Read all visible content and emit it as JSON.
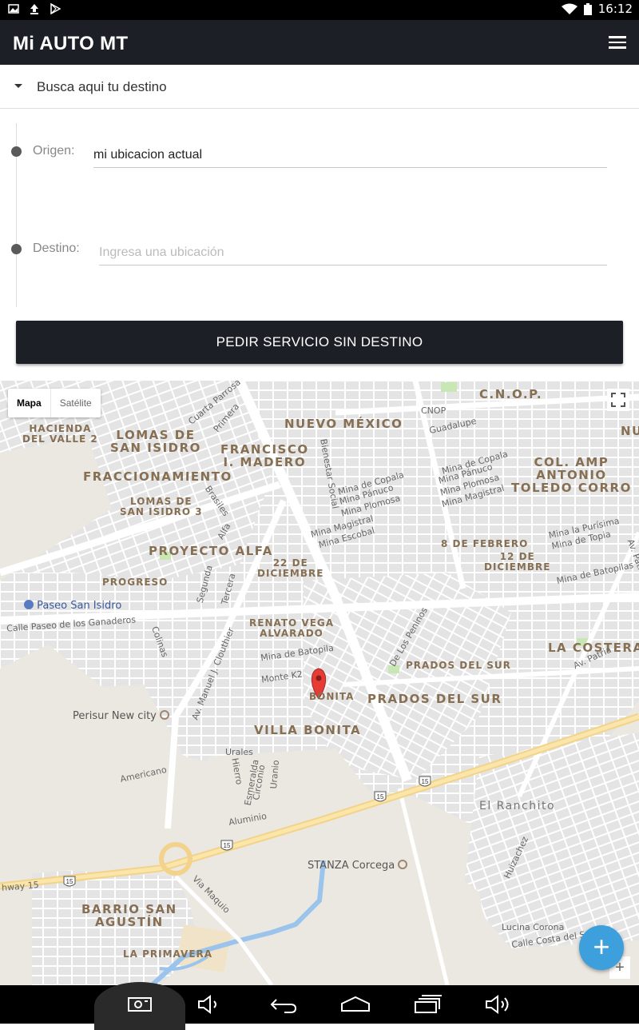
{
  "status_bar": {
    "time": "16:12",
    "icons": [
      "image-icon",
      "upload-icon",
      "play-store-icon",
      "wifi-icon",
      "battery-icon"
    ]
  },
  "app_bar": {
    "title": "Mi AUTO MT",
    "menu_icon": "hamburger-menu-icon"
  },
  "search_toggle": {
    "label": "Busca aqui tu destino",
    "icon": "caret-down-icon"
  },
  "form": {
    "origin_label": "Origen:",
    "origin_value": "mi ubicacion actual",
    "destination_label": "Destino:",
    "destination_placeholder": "Ingresa una ubicación",
    "destination_value": "",
    "request_button": "PEDIR SERVICIO SIN DESTINO"
  },
  "map": {
    "type_controls": {
      "map": "Mapa",
      "satellite": "Satélite",
      "selected": "Mapa"
    },
    "fullscreen_icon": "fullscreen-icon",
    "marker_icon": "red-map-pin-icon",
    "neighborhoods": {
      "cnop": "C.N.O.P.",
      "nuevo_mexico": "NUEVO MÉXICO",
      "nu": "NU",
      "hacienda_del_valle_2": "HACIENDA\nDEL VALLE 2",
      "lomas_de_san_isidro": "LOMAS DE\nSAN ISIDRO",
      "francisco_madero": "FRANCISCO\nI. MADERO",
      "fraccionamiento": "FRACCIONAMIENTO",
      "lomas_de_san_isidro_3": "LOMAS DE\nSAN ISIDRO 3",
      "col_amp_antonio": "COL. AMP\nANTONIO\nTOLEDO CORRO",
      "proyecto_alfa": "PROYECTO ALFA",
      "veintidos_diciembre": "22 DE\nDICIEMBRE",
      "ocho_febrero": "8 DE FEBRERO",
      "doce_diciembre": "12 DE\nDICIEMBRE",
      "progreso": "PROGRESO",
      "renato_vega": "RENATO VEGA\nALVARADO",
      "la_costera": "LA COSTERA",
      "prados_del_sur_small": "PRADOS DEL SUR",
      "prados_del_sur": "PRADOS DEL SUR",
      "bonita": "BONITA",
      "villa_bonita": "VILLA BONITA",
      "barrio_san_agustin": "BARRIO SAN\nAGUSTÍN",
      "la_primavera": "LA PRIMAVERA",
      "el_ranchito": "El Ranchito"
    },
    "streets": {
      "cuarta_parrosa": "Cuarta Parrosa",
      "primera": "Primera",
      "cnop_street": "CNOP",
      "guadalupe": "Guadalupe",
      "bienestar_social": "Bienestar Social",
      "mina_copala_a": "Mina de Copala",
      "mina_panuco_a": "Mina Pánuco",
      "mina_plomosa_a": "Mina Plomosa",
      "mina_magistral_a": "Mina Magistral",
      "mina_escobal": "Mina Escobal",
      "mina_copala_b": "Mina de Copala",
      "mina_panuco_b": "Mina Pánuco",
      "mina_plomosa_b": "Mina Plomosa",
      "mina_magistral_b": "Mina Magistral",
      "mina_purisima": "Mina la Purísima",
      "mina_topia": "Mina de Topia",
      "mina_batopilas_a": "Mina de Batopilas",
      "av_patria_a": "Av. Patria",
      "brasiles": "Brasiles",
      "alfa": "Alfa",
      "segunda": "Segunda",
      "tercera": "Tercera",
      "paseo_ganaderos": "Calle Paseo de los Ganaderos",
      "colinas": "Colinas",
      "av_clouthier": "Av. Manuel J. Clouthier",
      "mina_batopila_b": "Mina de Batopila",
      "monte_k2": "Monte K2",
      "de_los_peninos": "De Los Peninos",
      "av_patria_b": "Av. Patria",
      "americano": "Americano",
      "urales": "Urales",
      "hierro": "Hierro",
      "esmeralda": "Esmeralda",
      "circonio": "Circonio",
      "uranio": "Uranio",
      "aluminio": "Aluminio",
      "highway_15": "hway 15",
      "via_maquio": "Via Maquio",
      "huizachez": "Huizachez",
      "lucina_corona": "Lucina Corona",
      "calle_costa": "Calle Costa del Sol"
    },
    "pois": {
      "paseo_san_isidro": "Paseo San Isidro",
      "perisur": "Perisur New city",
      "stanza": "STANZA Corcega"
    },
    "route_shields": [
      "15",
      "15",
      "15",
      "15"
    ],
    "fab_icon": "plus-icon",
    "zoom_in": "+"
  },
  "nav_bar": {
    "icons": [
      "screenshot-icon",
      "volume-down-icon",
      "back-icon",
      "home-icon",
      "recents-icon",
      "volume-up-icon"
    ]
  }
}
